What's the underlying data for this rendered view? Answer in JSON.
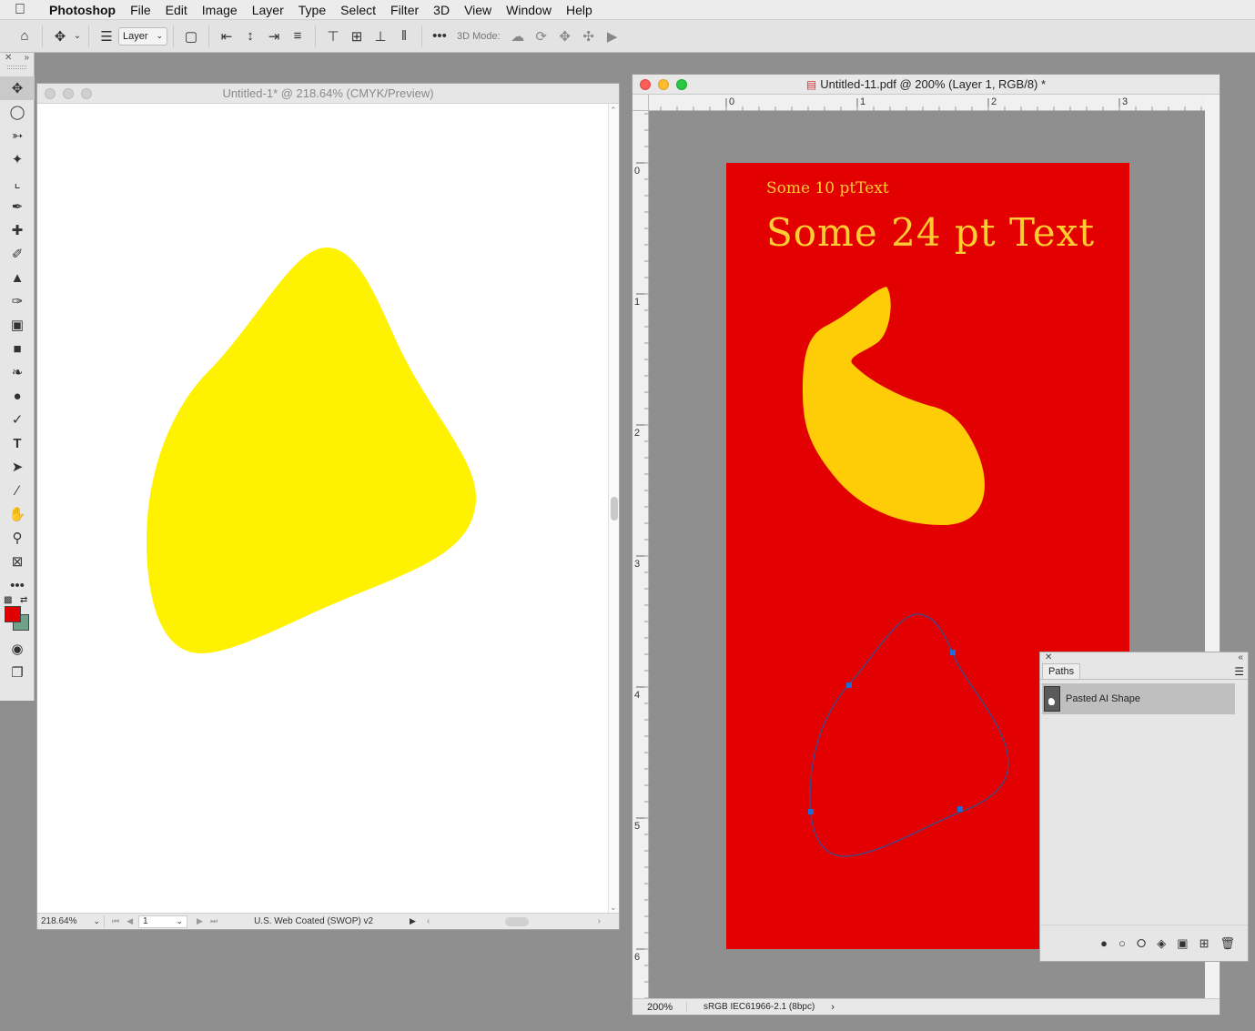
{
  "menubar": {
    "app": "Photoshop",
    "items": [
      "File",
      "Edit",
      "Image",
      "Layer",
      "Type",
      "Select",
      "Filter",
      "3D",
      "View",
      "Window",
      "Help"
    ]
  },
  "options": {
    "layer_select": "Layer",
    "mode_label": "3D Mode:"
  },
  "tools": {
    "icons": [
      "move-icon",
      "marquee-icon",
      "lasso-icon",
      "magic-wand-icon",
      "crop-icon",
      "eyedropper-icon",
      "healing-icon",
      "brush-icon",
      "stamp-icon",
      "history-brush-icon",
      "eraser-icon",
      "gradient-icon",
      "blur-icon",
      "dodge-icon",
      "pen-icon",
      "type-icon",
      "path-select-icon",
      "line-icon",
      "hand-icon",
      "zoom-icon",
      "frame-icon",
      "more-icon"
    ],
    "foreground_color": "#e00000",
    "background_color": "#6fa28b"
  },
  "doc1": {
    "title": "Untitled-1* @ 218.64% (CMYK/Preview)",
    "zoom": "218.64%",
    "page": "1",
    "profile": "U.S. Web Coated (SWOP) v2",
    "shape_color": "#fff200"
  },
  "doc2": {
    "title": "Untitled-11.pdf @ 200% (Layer 1, RGB/8) *",
    "ruler_h": [
      "0",
      "1",
      "2",
      "3"
    ],
    "ruler_v": [
      "0",
      "1",
      "2",
      "3",
      "4",
      "5",
      "6"
    ],
    "text_small": "Some 10 ptText",
    "text_large": "Some 24 pt Text",
    "artboard_color": "#e20000",
    "text_color": "#ffcc33",
    "zoom": "200%",
    "profile": "sRGB IEC61966-2.1 (8bpc)"
  },
  "paths_panel": {
    "tab": "Paths",
    "items": [
      "Pasted AI Shape"
    ]
  }
}
